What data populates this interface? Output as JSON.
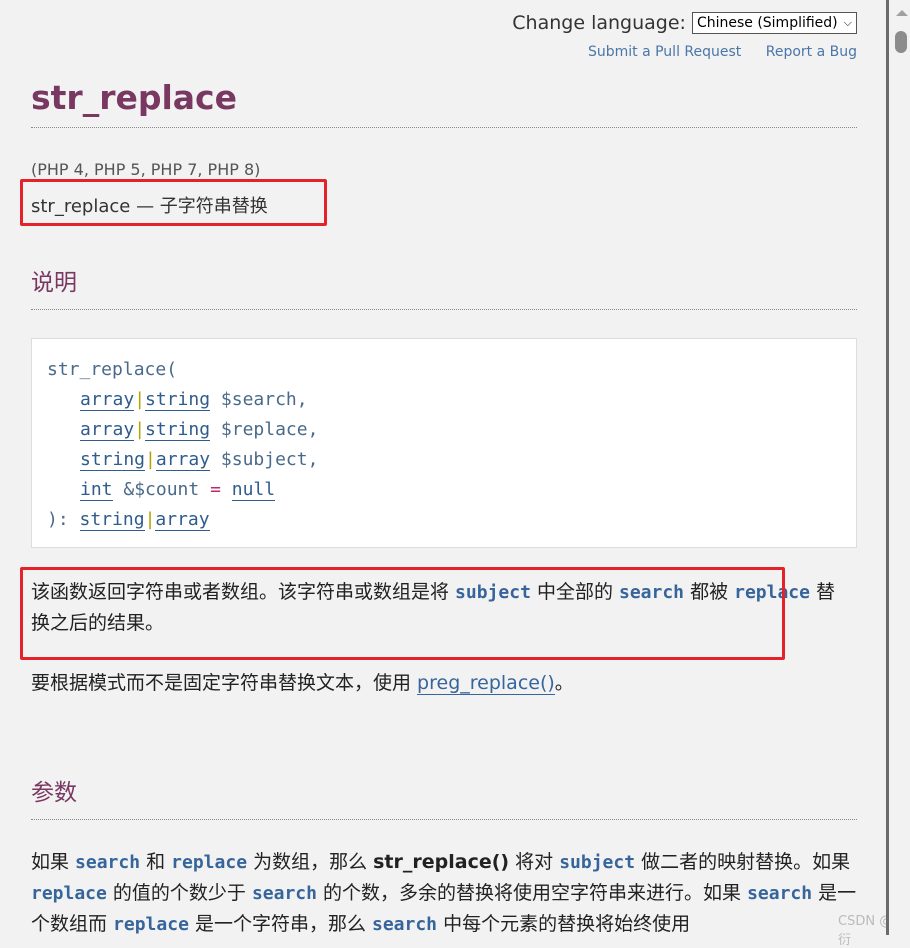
{
  "header": {
    "change_language_label": "Change language:",
    "language_selected": "Chinese (Simplified)",
    "submit_pr": "Submit a Pull Request",
    "report_bug": "Report a Bug"
  },
  "title": "str_replace",
  "versions": "(PHP 4, PHP 5, PHP 7, PHP 8)",
  "refname": "str_replace — 子字符串替换",
  "description": {
    "heading": "说明",
    "code": {
      "fn": "str_replace(",
      "p1_t1": "array",
      "p1_t2": "string",
      "p1_var": "$search,",
      "p2_t1": "array",
      "p2_t2": "string",
      "p2_var": "$replace,",
      "p3_t1": "string",
      "p3_t2": "array",
      "p3_var": "$subject,",
      "p4_t": "int",
      "p4_var": "&$count",
      "p4_eq": "=",
      "p4_default": "null",
      "ret_prefix": "):",
      "ret_t1": "string",
      "ret_t2": "array"
    },
    "para1": {
      "a": "该函数返回字符串或者数组。该字符串或数组是将 ",
      "subject": "subject",
      "b": " 中全部的 ",
      "search": "search",
      "c": " 都被 ",
      "replace": "replace",
      "d": " 替换之后的结果。"
    },
    "para2": {
      "a": "要根据模式而不是固定字符串替换文本，使用 ",
      "link": "preg_replace()",
      "b": "。"
    }
  },
  "parameters": {
    "heading": "参数",
    "para": {
      "a": "如果 ",
      "search": "search",
      "b": " 和 ",
      "replace": "replace",
      "c": " 为数组，那么 ",
      "fn": "str_replace()",
      "d": " 将对 ",
      "subject": "subject",
      "e": " 做二者的映射替换。如果 ",
      "replace2": "replace",
      "f": " 的值的个数少于 ",
      "search2": "search",
      "g": " 的个数，多余的替换将使用空字符串来进行。如果 ",
      "search3": "search",
      "h": " 是一个数组而 ",
      "replace3": "replace",
      "i": " 是一个字符串，那么 ",
      "search4": "search",
      "j": " 中每个元素的替换将始终使用"
    }
  },
  "watermark": "CSDN @君衍",
  "colors": {
    "accent": "#793862",
    "link": "#4a76a8",
    "highlight_box": "#e5222a"
  }
}
